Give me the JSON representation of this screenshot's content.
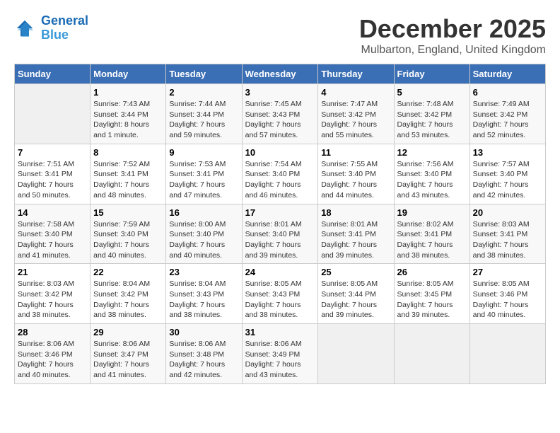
{
  "header": {
    "logo_line1": "General",
    "logo_line2": "Blue",
    "title": "December 2025",
    "subtitle": "Mulbarton, England, United Kingdom"
  },
  "calendar": {
    "days_of_week": [
      "Sunday",
      "Monday",
      "Tuesday",
      "Wednesday",
      "Thursday",
      "Friday",
      "Saturday"
    ],
    "weeks": [
      [
        {
          "day": "",
          "info": ""
        },
        {
          "day": "1",
          "info": "Sunrise: 7:43 AM\nSunset: 3:44 PM\nDaylight: 8 hours\nand 1 minute."
        },
        {
          "day": "2",
          "info": "Sunrise: 7:44 AM\nSunset: 3:44 PM\nDaylight: 7 hours\nand 59 minutes."
        },
        {
          "day": "3",
          "info": "Sunrise: 7:45 AM\nSunset: 3:43 PM\nDaylight: 7 hours\nand 57 minutes."
        },
        {
          "day": "4",
          "info": "Sunrise: 7:47 AM\nSunset: 3:42 PM\nDaylight: 7 hours\nand 55 minutes."
        },
        {
          "day": "5",
          "info": "Sunrise: 7:48 AM\nSunset: 3:42 PM\nDaylight: 7 hours\nand 53 minutes."
        },
        {
          "day": "6",
          "info": "Sunrise: 7:49 AM\nSunset: 3:42 PM\nDaylight: 7 hours\nand 52 minutes."
        }
      ],
      [
        {
          "day": "7",
          "info": "Sunrise: 7:51 AM\nSunset: 3:41 PM\nDaylight: 7 hours\nand 50 minutes."
        },
        {
          "day": "8",
          "info": "Sunrise: 7:52 AM\nSunset: 3:41 PM\nDaylight: 7 hours\nand 48 minutes."
        },
        {
          "day": "9",
          "info": "Sunrise: 7:53 AM\nSunset: 3:41 PM\nDaylight: 7 hours\nand 47 minutes."
        },
        {
          "day": "10",
          "info": "Sunrise: 7:54 AM\nSunset: 3:40 PM\nDaylight: 7 hours\nand 46 minutes."
        },
        {
          "day": "11",
          "info": "Sunrise: 7:55 AM\nSunset: 3:40 PM\nDaylight: 7 hours\nand 44 minutes."
        },
        {
          "day": "12",
          "info": "Sunrise: 7:56 AM\nSunset: 3:40 PM\nDaylight: 7 hours\nand 43 minutes."
        },
        {
          "day": "13",
          "info": "Sunrise: 7:57 AM\nSunset: 3:40 PM\nDaylight: 7 hours\nand 42 minutes."
        }
      ],
      [
        {
          "day": "14",
          "info": "Sunrise: 7:58 AM\nSunset: 3:40 PM\nDaylight: 7 hours\nand 41 minutes."
        },
        {
          "day": "15",
          "info": "Sunrise: 7:59 AM\nSunset: 3:40 PM\nDaylight: 7 hours\nand 40 minutes."
        },
        {
          "day": "16",
          "info": "Sunrise: 8:00 AM\nSunset: 3:40 PM\nDaylight: 7 hours\nand 40 minutes."
        },
        {
          "day": "17",
          "info": "Sunrise: 8:01 AM\nSunset: 3:40 PM\nDaylight: 7 hours\nand 39 minutes."
        },
        {
          "day": "18",
          "info": "Sunrise: 8:01 AM\nSunset: 3:41 PM\nDaylight: 7 hours\nand 39 minutes."
        },
        {
          "day": "19",
          "info": "Sunrise: 8:02 AM\nSunset: 3:41 PM\nDaylight: 7 hours\nand 38 minutes."
        },
        {
          "day": "20",
          "info": "Sunrise: 8:03 AM\nSunset: 3:41 PM\nDaylight: 7 hours\nand 38 minutes."
        }
      ],
      [
        {
          "day": "21",
          "info": "Sunrise: 8:03 AM\nSunset: 3:42 PM\nDaylight: 7 hours\nand 38 minutes."
        },
        {
          "day": "22",
          "info": "Sunrise: 8:04 AM\nSunset: 3:42 PM\nDaylight: 7 hours\nand 38 minutes."
        },
        {
          "day": "23",
          "info": "Sunrise: 8:04 AM\nSunset: 3:43 PM\nDaylight: 7 hours\nand 38 minutes."
        },
        {
          "day": "24",
          "info": "Sunrise: 8:05 AM\nSunset: 3:43 PM\nDaylight: 7 hours\nand 38 minutes."
        },
        {
          "day": "25",
          "info": "Sunrise: 8:05 AM\nSunset: 3:44 PM\nDaylight: 7 hours\nand 39 minutes."
        },
        {
          "day": "26",
          "info": "Sunrise: 8:05 AM\nSunset: 3:45 PM\nDaylight: 7 hours\nand 39 minutes."
        },
        {
          "day": "27",
          "info": "Sunrise: 8:05 AM\nSunset: 3:46 PM\nDaylight: 7 hours\nand 40 minutes."
        }
      ],
      [
        {
          "day": "28",
          "info": "Sunrise: 8:06 AM\nSunset: 3:46 PM\nDaylight: 7 hours\nand 40 minutes."
        },
        {
          "day": "29",
          "info": "Sunrise: 8:06 AM\nSunset: 3:47 PM\nDaylight: 7 hours\nand 41 minutes."
        },
        {
          "day": "30",
          "info": "Sunrise: 8:06 AM\nSunset: 3:48 PM\nDaylight: 7 hours\nand 42 minutes."
        },
        {
          "day": "31",
          "info": "Sunrise: 8:06 AM\nSunset: 3:49 PM\nDaylight: 7 hours\nand 43 minutes."
        },
        {
          "day": "",
          "info": ""
        },
        {
          "day": "",
          "info": ""
        },
        {
          "day": "",
          "info": ""
        }
      ]
    ]
  }
}
